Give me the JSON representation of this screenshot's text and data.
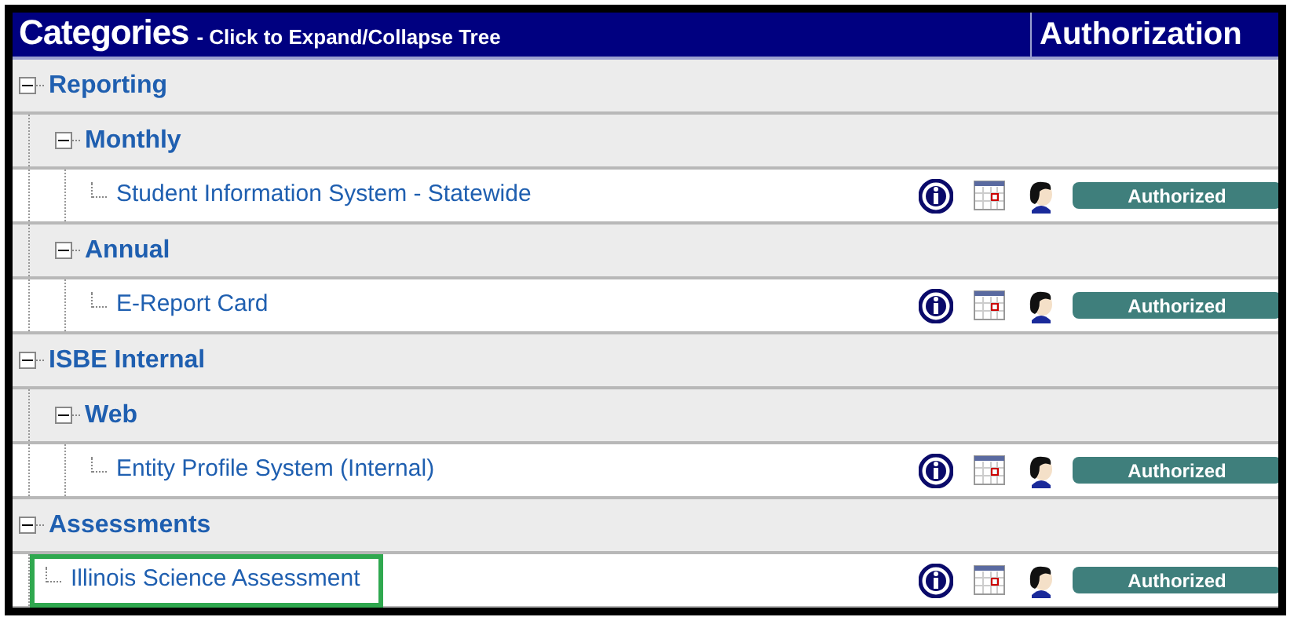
{
  "header": {
    "title": "Categories",
    "subtitle": "- Click to Expand/Collapse Tree",
    "column_2": "Authorization"
  },
  "tree": [
    {
      "kind": "category",
      "label": "Reporting",
      "expanded": true,
      "children": [
        {
          "kind": "category",
          "label": "Monthly",
          "expanded": true,
          "children": [
            {
              "kind": "report",
              "label": "Student Information System - Statewide",
              "status": "Authorized",
              "highlighted": false
            }
          ]
        },
        {
          "kind": "category",
          "label": "Annual",
          "expanded": true,
          "children": [
            {
              "kind": "report",
              "label": "E-Report Card",
              "status": "Authorized",
              "highlighted": false
            }
          ]
        }
      ]
    },
    {
      "kind": "category",
      "label": "ISBE Internal",
      "expanded": true,
      "children": [
        {
          "kind": "category",
          "label": "Web",
          "expanded": true,
          "children": [
            {
              "kind": "report",
              "label": "Entity Profile System (Internal)",
              "status": "Authorized",
              "highlighted": false
            }
          ]
        }
      ]
    },
    {
      "kind": "category",
      "label": "Assessments",
      "expanded": true,
      "children": [
        {
          "kind": "report",
          "label": "Illinois Science Assessment",
          "status": "Authorized",
          "highlighted": true
        }
      ]
    }
  ]
}
